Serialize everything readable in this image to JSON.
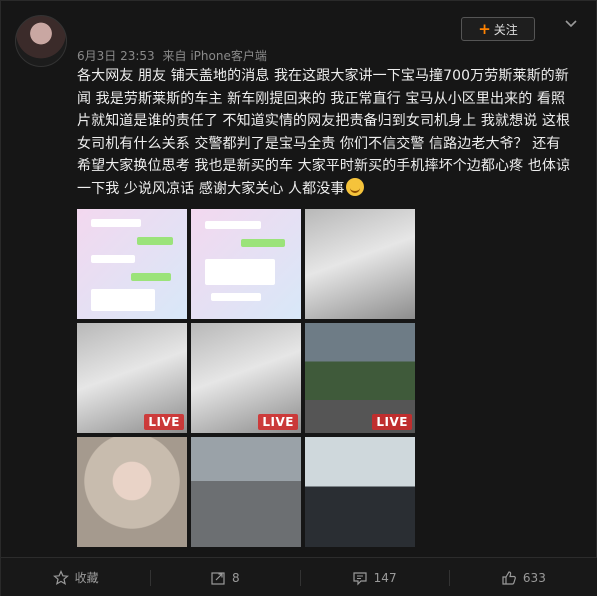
{
  "header": {
    "follow_label": "关注",
    "date": "6月3日 23:53",
    "source": "来自 iPhone客户端"
  },
  "post": {
    "text": "各大网友 朋友 铺天盖地的消息 我在这跟大家讲一下宝马撞700万劳斯莱斯的新闻 我是劳斯莱斯的车主 新车刚提回来的 我正常直行 宝马从小区里出来的 看照片就知道是谁的责任了 不知道实情的网友把责备归到女司机身上 我就想说 这根女司机有什么关系 交警都判了是宝马全责 你们不信交警 信路边老大爷？ 还有 希望大家换位思考 我也是新买的车 大家平时新买的手机摔坏个边都心疼 也体谅一下我 少说风凉话 感谢大家关心 人都没事",
    "emoji": "smile-emoji"
  },
  "images": [
    {
      "kind": "chat-screenshot",
      "badge": ""
    },
    {
      "kind": "chat-screenshot",
      "badge": ""
    },
    {
      "kind": "car-crash-photo",
      "badge": ""
    },
    {
      "kind": "car-crash-photo",
      "badge": "LIVE"
    },
    {
      "kind": "car-crash-photo",
      "badge": "LIVE"
    },
    {
      "kind": "street-photo",
      "badge": "LIVE"
    },
    {
      "kind": "portrait-photo",
      "badge": ""
    },
    {
      "kind": "garage-photo",
      "badge": ""
    },
    {
      "kind": "portrait-photo",
      "badge": ""
    }
  ],
  "footer": {
    "favorite_label": "收藏",
    "repost_count": "8",
    "comment_count": "147",
    "like_count": "633"
  },
  "colors": {
    "background": "#161616",
    "accent": "#ff8200",
    "live_badge": "#d22828"
  }
}
